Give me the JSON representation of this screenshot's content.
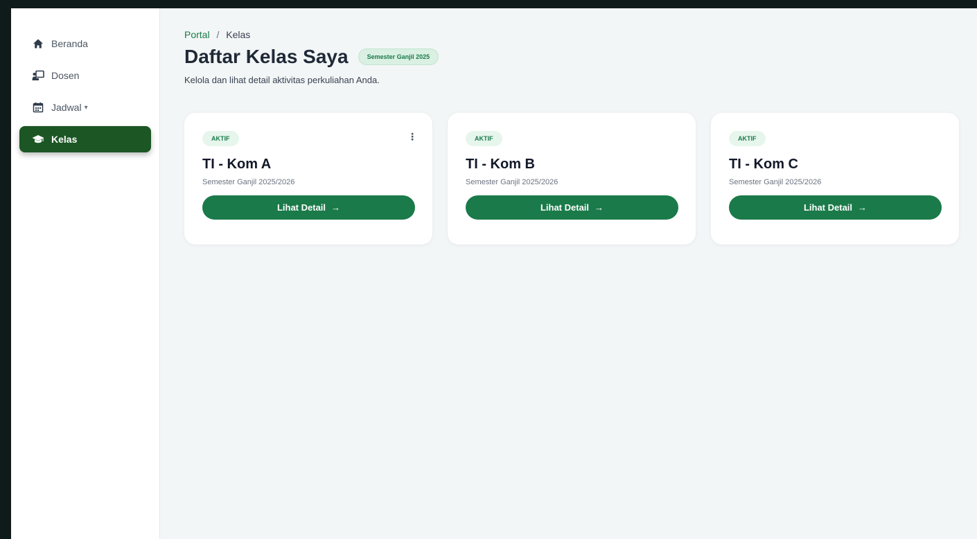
{
  "sidebar": {
    "items": [
      {
        "label": "Beranda",
        "icon": "home-icon"
      },
      {
        "label": "Dosen",
        "icon": "lecturer-icon"
      },
      {
        "label": "Jadwal",
        "icon": "calendar-icon",
        "caret": "▾"
      },
      {
        "label": "Kelas",
        "icon": "graduation-cap-icon",
        "active": true
      }
    ]
  },
  "breadcrumb": {
    "root": "Portal",
    "separator": "/",
    "current": "Kelas"
  },
  "header": {
    "title": "Daftar Kelas Saya",
    "badge": "Semester Ganjil 2025",
    "subtitle": "Kelola dan lihat detail aktivitas perkuliahan Anda."
  },
  "cards": [
    {
      "status": "AKTIF",
      "title": "TI - Kom A",
      "semester": "Semester Ganjil 2025/2026",
      "button": "Lihat Detail",
      "arrow": "→",
      "menu": "⋮"
    },
    {
      "status": "AKTIF",
      "title": "TI - Kom B",
      "semester": "Semester Ganjil 2025/2026",
      "button": "Lihat Detail",
      "arrow": "→"
    },
    {
      "status": "AKTIF",
      "title": "TI - Kom C",
      "semester": "Semester Ganjil 2025/2026",
      "button": "Lihat Detail",
      "arrow": "→"
    }
  ],
  "colors": {
    "primary": "#1b7a4a",
    "sidebar_active": "#1c5624",
    "background": "#f3f6f6"
  }
}
